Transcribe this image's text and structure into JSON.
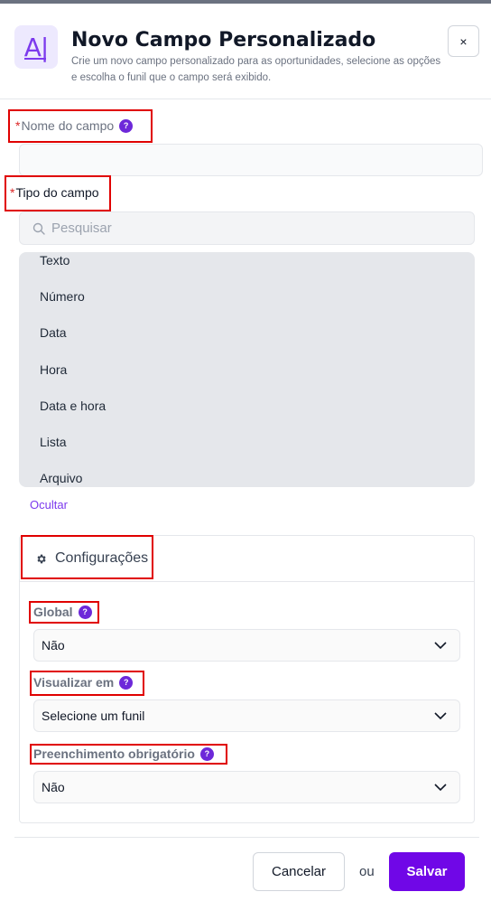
{
  "header": {
    "logo_text": "A|",
    "title": "Novo Campo Personalizado",
    "subtitle": "Crie um novo campo personalizado para as oportunidades, selecione as opções e escolha o funil que o campo será exibido.",
    "close_label": "×"
  },
  "field_name": {
    "required_mark": "*",
    "label": "Nome do campo",
    "help": "?",
    "value": ""
  },
  "field_type": {
    "required_mark": "*",
    "label": "Tipo do campo",
    "search_placeholder": "Pesquisar",
    "options": [
      "Texto",
      "Número",
      "Data",
      "Hora",
      "Data e hora",
      "Lista",
      "Arquivo"
    ],
    "hide_link": "Ocultar"
  },
  "settings": {
    "title": "Configurações",
    "global": {
      "label": "Global",
      "help": "?",
      "value": "Não"
    },
    "view_in": {
      "label": "Visualizar em",
      "help": "?",
      "value": "Selecione um funil"
    },
    "required_fill": {
      "label": "Preenchimento obrigatório",
      "help": "?",
      "value": "Não"
    }
  },
  "footer": {
    "cancel_label": "Cancelar",
    "or_label": "ou",
    "save_label": "Salvar"
  },
  "colors": {
    "accent": "#7007e7",
    "annotation": "#e00000",
    "help_badge": "#6d28d9"
  }
}
